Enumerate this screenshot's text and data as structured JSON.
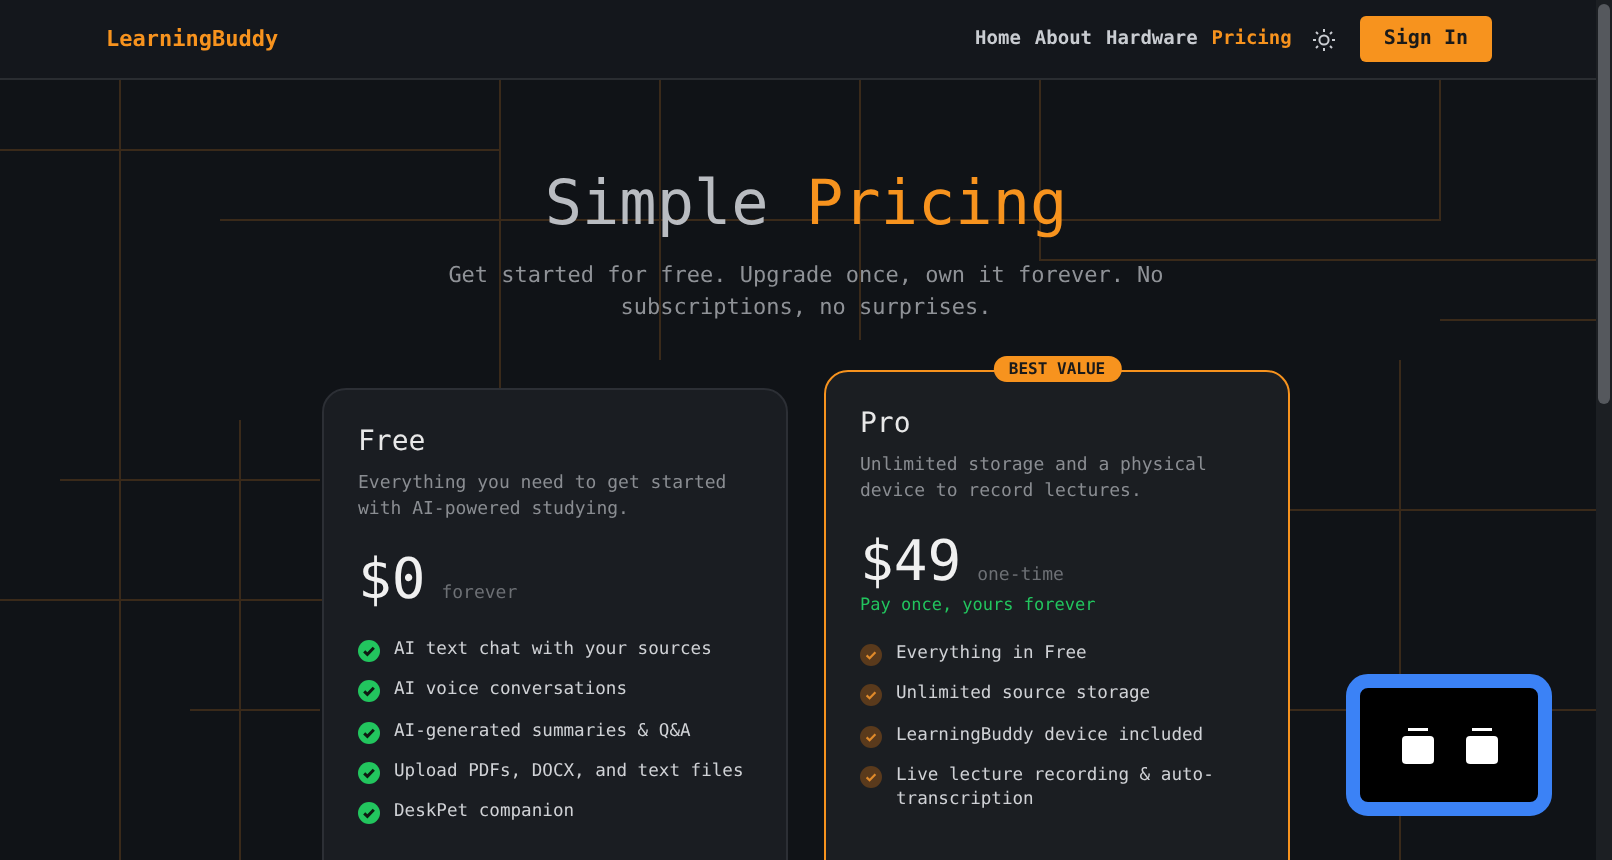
{
  "nav": {
    "brand": "LearningBuddy",
    "links": [
      {
        "label": "Home",
        "selected": false
      },
      {
        "label": "About",
        "selected": false
      },
      {
        "label": "Hardware",
        "selected": false
      },
      {
        "label": "Pricing",
        "selected": true
      }
    ],
    "sign_in": "Sign In"
  },
  "hero": {
    "title": "Simple",
    "title_highlight": "Pricing",
    "subtitle": "Get started for free. Upgrade once, own it forever. No subscriptions, no surprises."
  },
  "plans": [
    {
      "name": "Free",
      "highlighted": false,
      "description": "Everything you need to get started with AI-powered studying.",
      "price": "$0",
      "period": "forever",
      "features": [
        "AI text chat with your sources",
        "AI voice conversations",
        "AI-generated summaries & Q&A",
        "Upload PDFs, DOCX, and text files",
        "DeskPet companion"
      ]
    },
    {
      "name": "Pro",
      "highlighted": true,
      "badge": "BEST VALUE",
      "description": "Unlimited storage and a physical device to record lectures.",
      "price": "$49",
      "period": "one-time",
      "note": "Pay once, yours forever",
      "features": [
        "Everything in Free",
        "Unlimited source storage",
        "LearningBuddy device included",
        "Live lecture recording & auto-transcription"
      ]
    }
  ]
}
